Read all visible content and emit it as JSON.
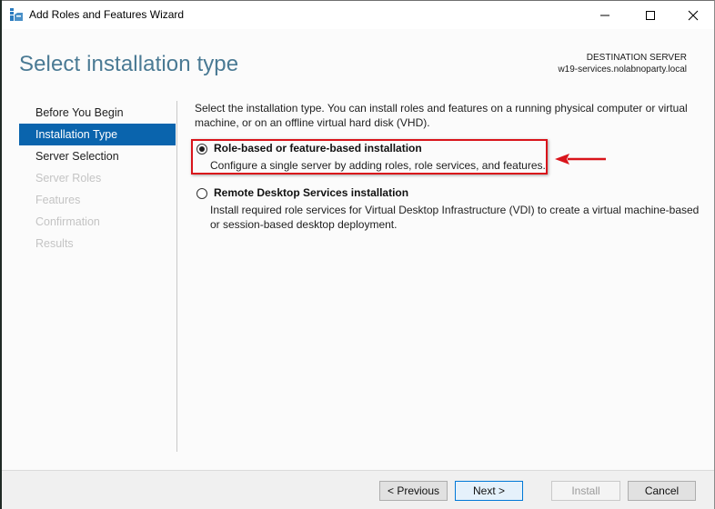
{
  "window": {
    "title": "Add Roles and Features Wizard",
    "controls": {
      "minimize": "minimize",
      "maximize": "maximize",
      "close": "close"
    }
  },
  "header": {
    "page_title": "Select installation type",
    "destination_label": "DESTINATION SERVER",
    "destination_server": "w19-services.nolabnoparty.local"
  },
  "nav": {
    "items": [
      {
        "label": "Before You Begin",
        "state": "normal"
      },
      {
        "label": "Installation Type",
        "state": "active"
      },
      {
        "label": "Server Selection",
        "state": "normal"
      },
      {
        "label": "Server Roles",
        "state": "disabled"
      },
      {
        "label": "Features",
        "state": "disabled"
      },
      {
        "label": "Confirmation",
        "state": "disabled"
      },
      {
        "label": "Results",
        "state": "disabled"
      }
    ]
  },
  "content": {
    "intro": "Select the installation type. You can install roles and features on a running physical computer or virtual machine, or on an offline virtual hard disk (VHD).",
    "options": [
      {
        "label": "Role-based or feature-based installation",
        "description": "Configure a single server by adding roles, role services, and features.",
        "selected": true
      },
      {
        "label": "Remote Desktop Services installation",
        "description": "Install required role services for Virtual Desktop Infrastructure (VDI) to create a virtual machine-based or session-based desktop deployment.",
        "selected": false
      }
    ]
  },
  "annotation": {
    "color": "#d9141b"
  },
  "footer": {
    "previous": "< Previous",
    "next": "Next >",
    "install": "Install",
    "cancel": "Cancel"
  },
  "colors": {
    "accent": "#0a64ad",
    "title": "#4a7a94"
  }
}
